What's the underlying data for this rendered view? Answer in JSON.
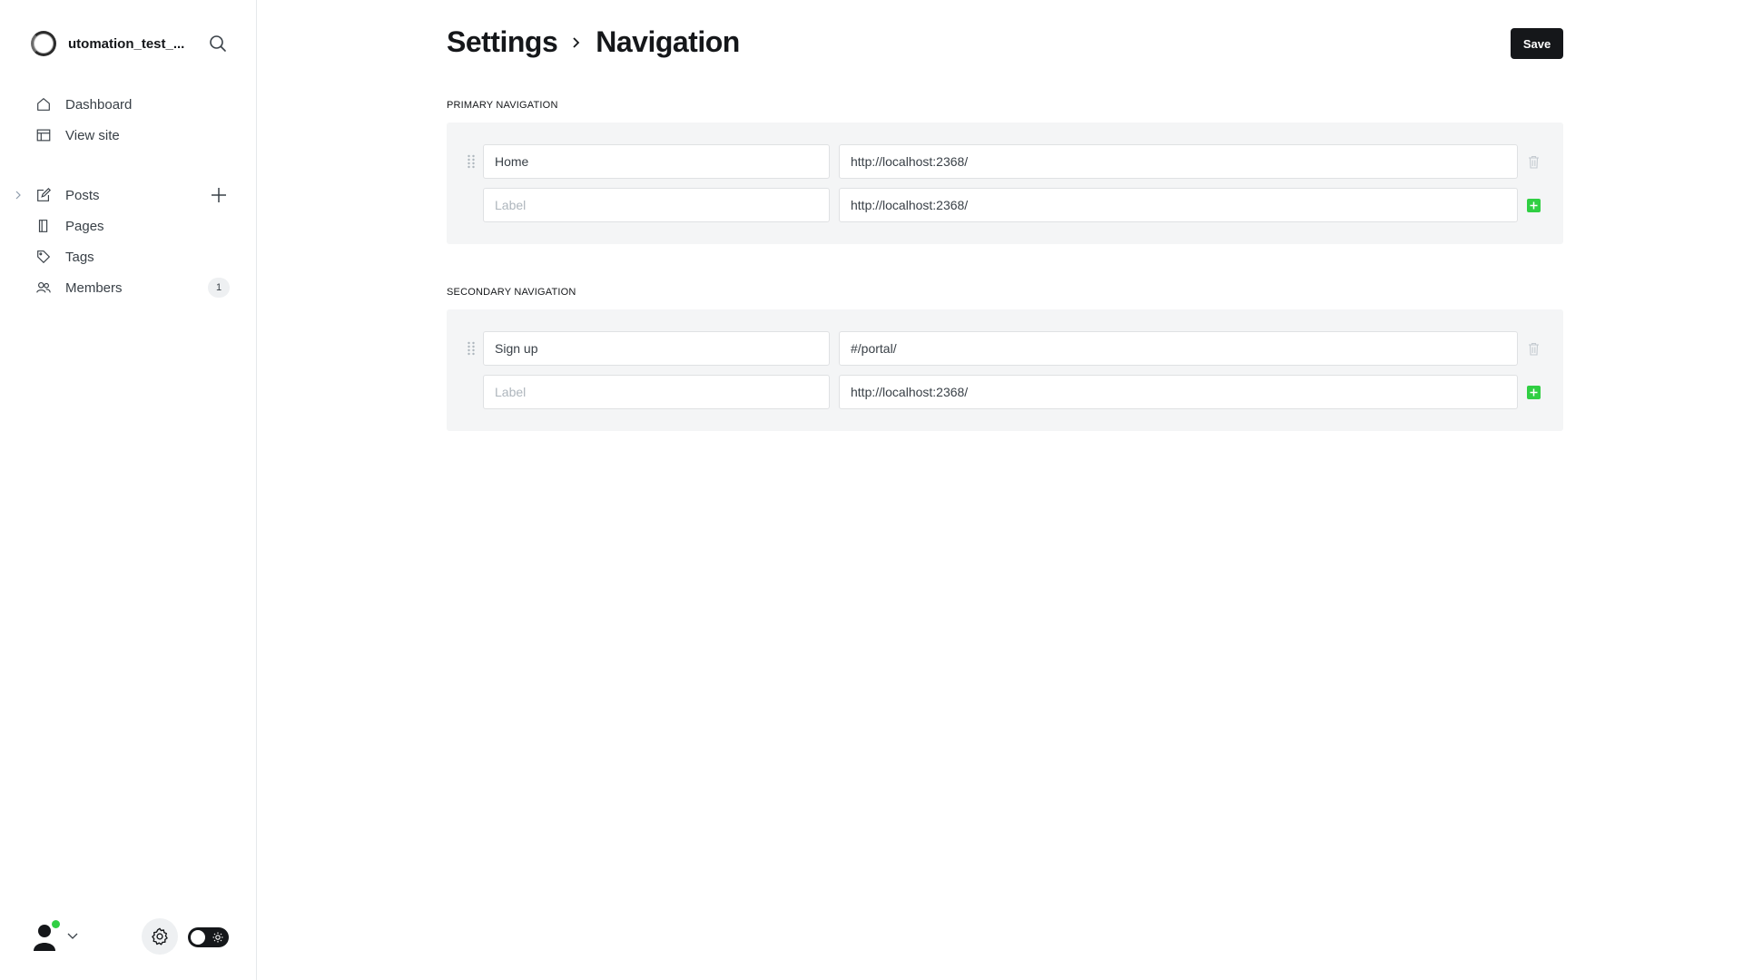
{
  "sidebar": {
    "site_name": "utomation_test_...",
    "items": [
      {
        "label": "Dashboard",
        "icon": "home-icon"
      },
      {
        "label": "View site",
        "icon": "layout-icon"
      },
      {
        "label": "Posts",
        "icon": "edit-icon"
      },
      {
        "label": "Pages",
        "icon": "page-icon"
      },
      {
        "label": "Tags",
        "icon": "tag-icon"
      },
      {
        "label": "Members",
        "icon": "members-icon",
        "badge": "1"
      }
    ]
  },
  "header": {
    "breadcrumb_root": "Settings",
    "breadcrumb_current": "Navigation",
    "save_label": "Save"
  },
  "primary": {
    "title": "PRIMARY NAVIGATION",
    "rows": [
      {
        "label": "Home",
        "url": "http://localhost:2368/"
      }
    ],
    "new_row": {
      "label_placeholder": "Label",
      "url": "http://localhost:2368/"
    }
  },
  "secondary": {
    "title": "SECONDARY NAVIGATION",
    "rows": [
      {
        "label": "Sign up",
        "url": "#/portal/"
      }
    ],
    "new_row": {
      "label_placeholder": "Label",
      "url": "http://localhost:2368/"
    }
  },
  "colors": {
    "accent_green": "#30cf43",
    "primary_dark": "#15171a",
    "panel_bg": "#f4f5f6"
  }
}
